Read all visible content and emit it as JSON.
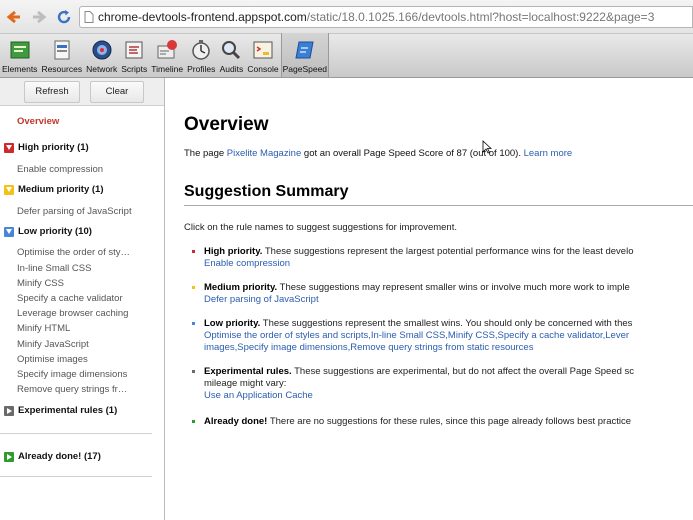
{
  "browser": {
    "url_host": "chrome-devtools-frontend.appspot.com",
    "url_path": "/static/18.0.1025.166/devtools.html?host=localhost:9222&page=3"
  },
  "toolbar": {
    "tabs": [
      {
        "label": "Elements",
        "icon": "elements-icon"
      },
      {
        "label": "Resources",
        "icon": "resources-icon"
      },
      {
        "label": "Network",
        "icon": "network-icon"
      },
      {
        "label": "Scripts",
        "icon": "scripts-icon"
      },
      {
        "label": "Timeline",
        "icon": "timeline-icon"
      },
      {
        "label": "Profiles",
        "icon": "profiles-icon"
      },
      {
        "label": "Audits",
        "icon": "audits-icon"
      },
      {
        "label": "Console",
        "icon": "console-icon"
      },
      {
        "label": "PageSpeed",
        "icon": "pagespeed-icon",
        "active": true
      }
    ]
  },
  "sidebar": {
    "refresh_label": "Refresh",
    "clear_label": "Clear",
    "overview_label": "Overview",
    "high": {
      "label": "High priority (1)",
      "items": [
        "Enable compression"
      ]
    },
    "medium": {
      "label": "Medium priority (1)",
      "items": [
        "Defer parsing of JavaScript"
      ]
    },
    "low": {
      "label": "Low priority (10)",
      "items": [
        "Optimise the order of sty…",
        "In-line Small CSS",
        "Minify CSS",
        "Specify a cache validator",
        "Leverage browser caching",
        "Minify HTML",
        "Minify JavaScript",
        "Optimise images",
        "Specify image dimensions",
        "Remove query strings fr…"
      ]
    },
    "experimental": {
      "label": "Experimental rules (1)"
    },
    "done": {
      "label": "Already done! (17)"
    }
  },
  "colors": {
    "high": "#cc2b2b",
    "medium": "#f2c21b",
    "low": "#4a86d8",
    "experimental": "#6a6a6a",
    "done": "#2e9b2e",
    "link": "#2a5db0"
  },
  "main": {
    "title": "Overview",
    "score_pre": "The page ",
    "score_link": "Pixelite Magazine",
    "score_mid": " got an overall Page Speed Score of 87 (out of 100). ",
    "learn_more": "Learn more",
    "suggestion_title": "Suggestion Summary",
    "intro": "Click on the rule names to suggest suggestions for improvement.",
    "rules": {
      "high": {
        "head": "High priority.",
        "text": " These suggestions represent the largest potential performance wins for the least develo",
        "links1": "Enable compression"
      },
      "medium": {
        "head": "Medium priority.",
        "text": " These suggestions may represent smaller wins or involve much more work to imple",
        "links1": "Defer parsing of JavaScript"
      },
      "low": {
        "head": "Low priority.",
        "text": " These suggestions represent the smallest wins. You should only be concerned with thes",
        "links1": "Optimise the order of styles and scripts,In-line Small CSS,Minify CSS,Specify a cache validator,Lever",
        "links2": "images,Specify image dimensions,Remove query strings from static resources"
      },
      "experimental": {
        "head": "Experimental rules.",
        "text": " These suggestions are experimental, but do not affect the overall Page Speed sc",
        "text2": "mileage might vary:",
        "links1": "Use an Application Cache"
      },
      "done": {
        "head": "Already done!",
        "text": " There are no suggestions for these rules, since this page already follows best practice"
      }
    }
  }
}
